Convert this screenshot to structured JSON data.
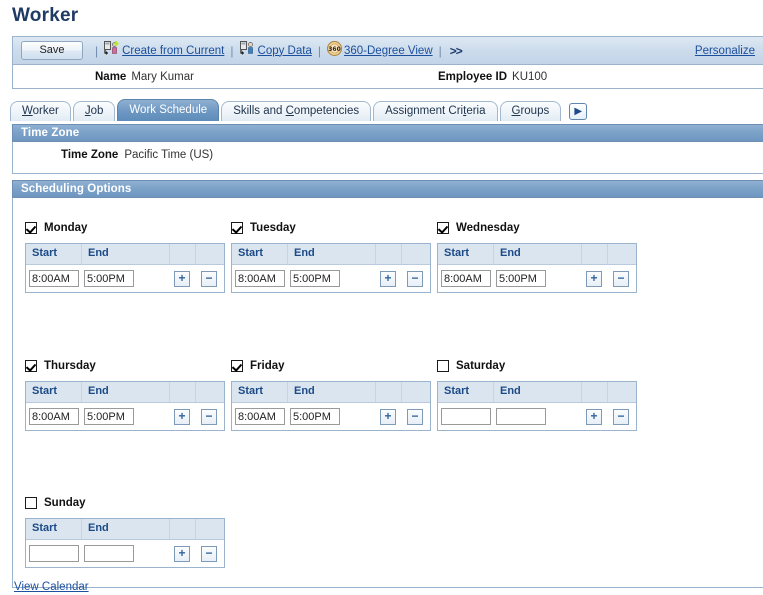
{
  "page": {
    "title": "Worker"
  },
  "toolbar": {
    "save_label": "Save",
    "separator": "|",
    "links": [
      {
        "label": "Create from Current",
        "icon": "person-add-icon"
      },
      {
        "label": "Copy Data",
        "icon": "person-copy-icon"
      },
      {
        "label": "360-Degree View",
        "icon": "360-icon"
      }
    ],
    "more_label": ">>",
    "personalize_label": "Personalize"
  },
  "identity": {
    "name_label": "Name",
    "name_value": "Mary Kumar",
    "employee_id_label": "Employee ID",
    "employee_id_value": "KU100"
  },
  "tabs": [
    {
      "label": "Worker",
      "accel": "W",
      "active": false
    },
    {
      "label": "Job",
      "accel": "J",
      "active": false
    },
    {
      "label": "Work Schedule",
      "accel": "",
      "active": true
    },
    {
      "label": "Skills and Competencies",
      "accel": "C",
      "active": false
    },
    {
      "label": "Assignment Criteria",
      "accel": "t",
      "active": false
    },
    {
      "label": "Groups",
      "accel": "G",
      "active": false
    }
  ],
  "tab_next_icon": "next-arrow-icon",
  "time_zone_panel": {
    "header": "Time Zone",
    "field_label": "Time Zone",
    "field_value": "Pacific Time (US)"
  },
  "scheduling_panel": {
    "header": "Scheduling Options",
    "grid_headers": {
      "start": "Start",
      "end": "End"
    },
    "add_icon": "plus-icon",
    "remove_icon": "minus-icon",
    "days": [
      {
        "name": "Monday",
        "checked": true,
        "start": "8:00AM",
        "end": "5:00PM"
      },
      {
        "name": "Tuesday",
        "checked": true,
        "start": "8:00AM",
        "end": "5:00PM"
      },
      {
        "name": "Wednesday",
        "checked": true,
        "start": "8:00AM",
        "end": "5:00PM"
      },
      {
        "name": "Thursday",
        "checked": true,
        "start": "8:00AM",
        "end": "5:00PM"
      },
      {
        "name": "Friday",
        "checked": true,
        "start": "8:00AM",
        "end": "5:00PM"
      },
      {
        "name": "Saturday",
        "checked": false,
        "start": "",
        "end": ""
      },
      {
        "name": "Sunday",
        "checked": false,
        "start": "",
        "end": ""
      }
    ]
  },
  "footer": {
    "view_calendar_label": "View Calendar"
  },
  "colors": {
    "title": "#1f3a63",
    "panel_header": "#7ba1c8",
    "link": "#1c4f9c",
    "grid_header_text": "#1b4a86",
    "active_tab": "#6d97c2"
  }
}
